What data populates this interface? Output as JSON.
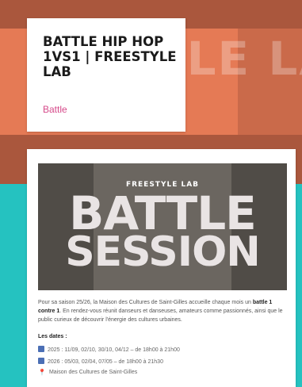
{
  "hero": {
    "background_word": "TYLE LA",
    "colors": {
      "orange": "#e57a55",
      "teal": "#25c2c0",
      "tag": "#d64a8a"
    }
  },
  "event": {
    "title": "BATTLE HIP HOP 1VS1 | FREESTYLE LAB",
    "category": "Battle"
  },
  "poster": {
    "kicker": "FREESTYLE LAB",
    "line1": "BATTLE",
    "line2": "SESSION"
  },
  "description": {
    "part1": "Pour sa saison 25/26, la Maison des Cultures de Saint-Gilles accueille chaque mois un ",
    "bold": "battle 1 contre 1",
    "part2": ". En rendez-vous réunit danseurs et danseuses, amateurs comme passionnés, ainsi que le public curieux de découvrir l'énergie des cultures urbaines."
  },
  "dates": {
    "title": "Les dates :",
    "line1": "2025 : 11/09, 02/10, 30/10, 04/12 – de 18h00 à 21h00",
    "line2": "2026 : 05/03, 02/04, 07/05 – de 18h00 à 21h30",
    "location": "Maison des Cultures de Saint-Gilles"
  }
}
